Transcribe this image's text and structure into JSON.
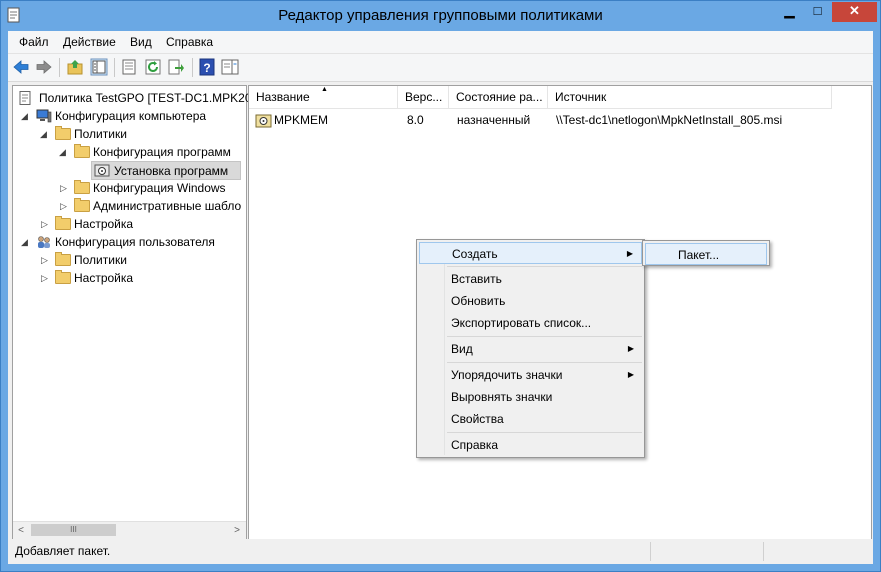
{
  "window": {
    "title": "Редактор управления групповыми политиками",
    "controls": {
      "minimize": "▁",
      "maximize": "□",
      "close": "✕"
    }
  },
  "menubar": {
    "items": [
      "Файл",
      "Действие",
      "Вид",
      "Справка"
    ]
  },
  "toolbar": {
    "icons": [
      "back-icon",
      "forward-icon",
      "up-folder-icon",
      "show-hide-tree-icon",
      "properties-icon",
      "refresh-icon",
      "export-list-icon",
      "help-icon",
      "show-action-pane-icon"
    ]
  },
  "tree": {
    "items": [
      {
        "label": "Политика TestGPO [TEST-DC1.MPK20"
      },
      {
        "label": "Конфигурация компьютера"
      },
      {
        "label": "Политики"
      },
      {
        "label": "Конфигурация программ"
      },
      {
        "label": "Установка программ"
      },
      {
        "label": "Конфигурация Windows"
      },
      {
        "label": "Административные шабло"
      },
      {
        "label": "Настройка"
      },
      {
        "label": "Конфигурация пользователя"
      },
      {
        "label": "Политики"
      },
      {
        "label": "Настройка"
      }
    ],
    "scroll": {
      "left": "<",
      "thumb": "III",
      "right": ">"
    }
  },
  "list": {
    "columns": [
      "Название",
      "Верс...",
      "Состояние ра...",
      "Источник"
    ],
    "sort_indicator": "▲",
    "rows": [
      {
        "name": "MPKMEM",
        "version": "8.0",
        "state": "назначенный",
        "source": "\\\\Test-dc1\\netlogon\\MpkNetInstall_805.msi"
      }
    ]
  },
  "context_menu": {
    "items": [
      {
        "label": "Создать",
        "submenu": true,
        "highlighted": true
      },
      {
        "label": "Вставить"
      },
      {
        "label": "Обновить"
      },
      {
        "label": "Экспортировать список..."
      },
      {
        "label": "Вид",
        "submenu": true
      },
      {
        "label": "Упорядочить значки",
        "submenu": true
      },
      {
        "label": "Выровнять значки"
      },
      {
        "label": "Свойства"
      },
      {
        "label": "Справка"
      }
    ],
    "submenu_arrow": "▶",
    "submenu": {
      "items": [
        {
          "label": "Пакет...",
          "highlighted": true
        }
      ]
    }
  },
  "statusbar": {
    "text": "Добавляет пакет."
  }
}
